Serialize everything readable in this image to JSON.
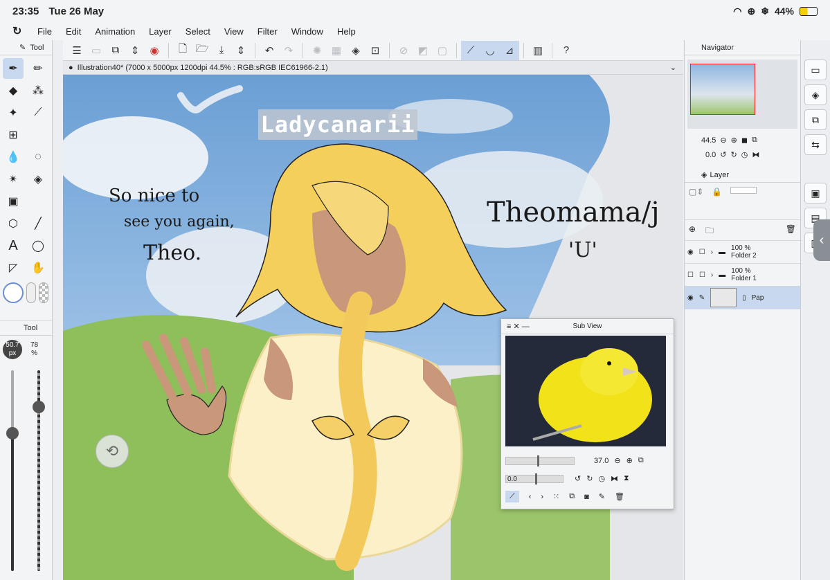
{
  "status": {
    "time": "23:35",
    "date": "Tue 26 May",
    "battery": "44%"
  },
  "menu": [
    "File",
    "Edit",
    "Animation",
    "Layer",
    "Select",
    "View",
    "Filter",
    "Window",
    "Help"
  ],
  "tool_panel": {
    "tab": "Tool",
    "sub_tab": "Tool"
  },
  "brush": {
    "size": "50.7",
    "size_unit": "px",
    "opacity": "78",
    "opacity_unit": "%"
  },
  "document": {
    "tab_title": "Illustration40* (7000 x 5000px 1200dpi 44.5% : RGB:sRGB IEC61966-2.1)"
  },
  "canvas_text": {
    "banner": "Ladycanarii",
    "note_line1": "So nice to",
    "note_line2": "see you again,",
    "note_line3": "Theo.",
    "signature": "Theomama/j",
    "face": "'U'"
  },
  "navigator": {
    "tab": "Navigator",
    "zoom": "44.5",
    "rotation": "0.0"
  },
  "layer_panel": {
    "tab": "Layer",
    "layers": [
      {
        "opacity": "100 %",
        "name": "Folder 2"
      },
      {
        "opacity": "100 %",
        "name": "Folder 1"
      },
      {
        "opacity": "",
        "name": "Pap"
      }
    ]
  },
  "subview": {
    "title": "Sub View",
    "zoom": "37.0",
    "rotation": "0.0"
  },
  "colors": {
    "accent": "#c8d8ee",
    "sky": "#6b9fd4",
    "grass": "#8fbf5a",
    "hair": "#f5cf5c",
    "canary": "#f2e21a"
  }
}
